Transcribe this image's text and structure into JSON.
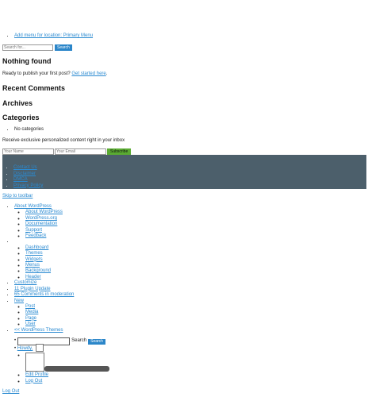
{
  "primary_menu": {
    "link": "Add menu for location: Primary Menu"
  },
  "search": {
    "placeholder": "Search for...",
    "button": "Search"
  },
  "nothing_found": {
    "title": "Nothing found",
    "text_prefix": "Ready to publish your first post? ",
    "link": "Get started here",
    "text_suffix": "."
  },
  "widgets": {
    "recent_comments": "Recent Comments",
    "archives": "Archives",
    "categories": "Categories",
    "categories_items": [
      "No categories"
    ]
  },
  "subscribe": {
    "text": "Receive exclusive personalized content right in your inbox",
    "name_placeholder": "Your Name",
    "email_placeholder": "Your Email",
    "button": "Subscribe"
  },
  "footer": {
    "links": [
      "Contact Us",
      "Disclaimer",
      "DMCA",
      "Privacy Policy"
    ],
    "bar_color": "#4c5f6b"
  },
  "admin_bar": {
    "skip": "Skip to toolbar",
    "about": "About WordPress",
    "about_items": [
      "About WordPress",
      "WordPress.org",
      "Documentation",
      "Support",
      "Feedback"
    ],
    "site_items": [
      "Dashboard",
      "Themes",
      "Widgets",
      "Menus",
      "Background",
      "Header"
    ],
    "customize": "Customize",
    "updates": "11 Plugin Update",
    "comments": "65 Comments in moderation",
    "new": "New",
    "new_items": [
      "Post",
      "Media",
      "Page",
      "User"
    ],
    "themes": "<< WordPress Themes",
    "search_label": "Search",
    "search_button": "Search",
    "howdy": "Howdy,",
    "edit_profile": "Edit Profile",
    "log_out": "Log Out"
  },
  "bottom_logout": "Log Out"
}
